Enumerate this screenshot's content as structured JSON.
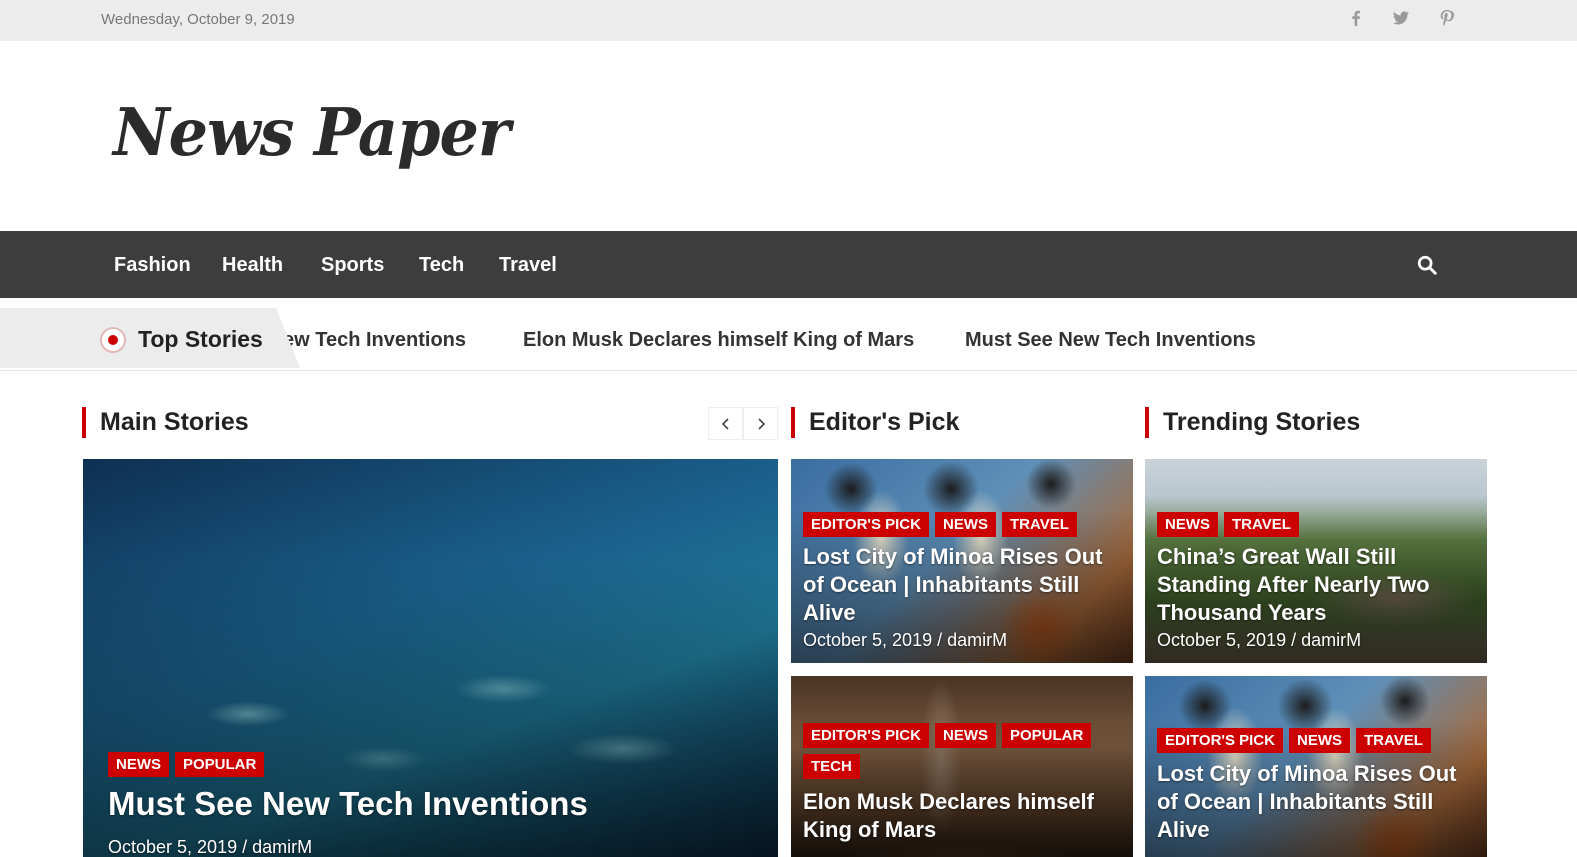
{
  "topbar": {
    "date": "Wednesday, October 9, 2019",
    "social_icons": [
      "facebook-icon",
      "twitter-icon",
      "pinterest-icon"
    ]
  },
  "site": {
    "logo_text": "News Paper"
  },
  "nav": {
    "items": [
      "Fashion",
      "Health",
      "Sports",
      "Tech",
      "Travel"
    ],
    "search_icon": "search-icon"
  },
  "ticker": {
    "label": "Top Stories",
    "items": [
      "ew Tech Inventions",
      "Elon Musk Declares himself King of Mars",
      "Must See New Tech Inventions"
    ]
  },
  "sections": {
    "main": "Main Stories",
    "editors": "Editor's Pick",
    "trending": "Trending Stories"
  },
  "main_story": {
    "tags": [
      "NEWS",
      "POPULAR"
    ],
    "title": "Must See New Tech Inventions",
    "meta": "October 5, 2019 / damirM"
  },
  "editors_pick": [
    {
      "tags": [
        "EDITOR'S PICK",
        "NEWS",
        "TRAVEL"
      ],
      "title": "Lost City of Minoa Rises Out of Ocean | Inhabitants Still Alive",
      "meta": "October 5, 2019 / damirM"
    },
    {
      "tags": [
        "EDITOR'S PICK",
        "NEWS",
        "POPULAR",
        "TECH"
      ],
      "title": "Elon Musk Declares himself King of Mars",
      "meta": ""
    }
  ],
  "trending": [
    {
      "tags": [
        "NEWS",
        "TRAVEL"
      ],
      "title": "China’s Great Wall Still Standing After Nearly Two Thousand Years",
      "meta": "October 5, 2019 / damirM"
    },
    {
      "tags": [
        "EDITOR'S PICK",
        "NEWS",
        "TRAVEL"
      ],
      "title": "Lost City of Minoa Rises Out of Ocean | Inhabitants Still Alive",
      "meta": ""
    }
  ],
  "colors": {
    "accent": "#cc0000",
    "nav_bg": "#3d3d3d",
    "topbar_bg": "#ececec"
  }
}
